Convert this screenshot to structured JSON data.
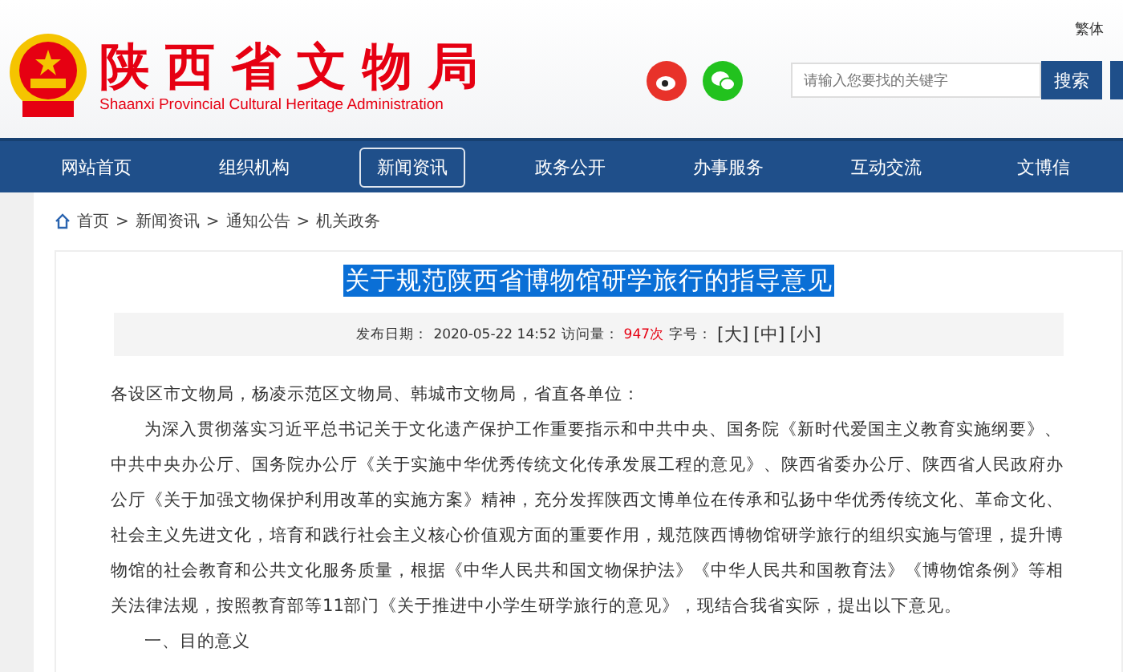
{
  "header": {
    "title": "陕西省文物局",
    "subtitle": "Shaanxi Provincial Cultural Heritage Administration",
    "language_link": "繁体",
    "search": {
      "placeholder": "请输入您要找的关键字",
      "button": "搜索"
    }
  },
  "nav": [
    {
      "label": "网站首页",
      "selected": false
    },
    {
      "label": "组织机构",
      "selected": false
    },
    {
      "label": "新闻资讯",
      "selected": true
    },
    {
      "label": "政务公开",
      "selected": false
    },
    {
      "label": "办事服务",
      "selected": false
    },
    {
      "label": "互动交流",
      "selected": false
    },
    {
      "label": "文博信",
      "selected": false
    }
  ],
  "breadcrumb": {
    "separator": ">",
    "items": [
      "首页",
      "新闻资讯",
      "通知公告",
      "机关政务"
    ]
  },
  "article": {
    "title": "关于规范陕西省博物馆研学旅行的指导意见",
    "publish_label": "发布日期：",
    "publish_date": "2020-05-22 14:52",
    "views_label": "访问量：",
    "views": "947次",
    "font_size_label": "字号：",
    "font_sizes": [
      "[大]",
      "[中]",
      "[小]"
    ],
    "paragraphs": [
      {
        "kind": "salutation",
        "text": "各设区市文物局，杨凌示范区文物局、韩城市文物局，省直各单位："
      },
      {
        "kind": "body",
        "text": "为深入贯彻落实习近平总书记关于文化遗产保护工作重要指示和中共中央、国务院《新时代爱国主义教育实施纲要》、中共中央办公厅、国务院办公厅《关于实施中华优秀传统文化传承发展工程的意见》、陕西省委办公厅、陕西省人民政府办公厅《关于加强文物保护利用改革的实施方案》精神，充分发挥陕西文博单位在传承和弘扬中华优秀传统文化、革命文化、社会主义先进文化，培育和践行社会主义核心价值观方面的重要作用，规范陕西博物馆研学旅行的组织实施与管理，提升博物馆的社会教育和公共文化服务质量，根据《中华人民共和国文物保护法》《中华人民共和国教育法》《博物馆条例》等相关法律法规，按照教育部等11部门《关于推进中小学生研学旅行的意见》，现结合我省实际，提出以下意见。"
      },
      {
        "kind": "body",
        "text": "一、目的意义"
      }
    ]
  }
}
